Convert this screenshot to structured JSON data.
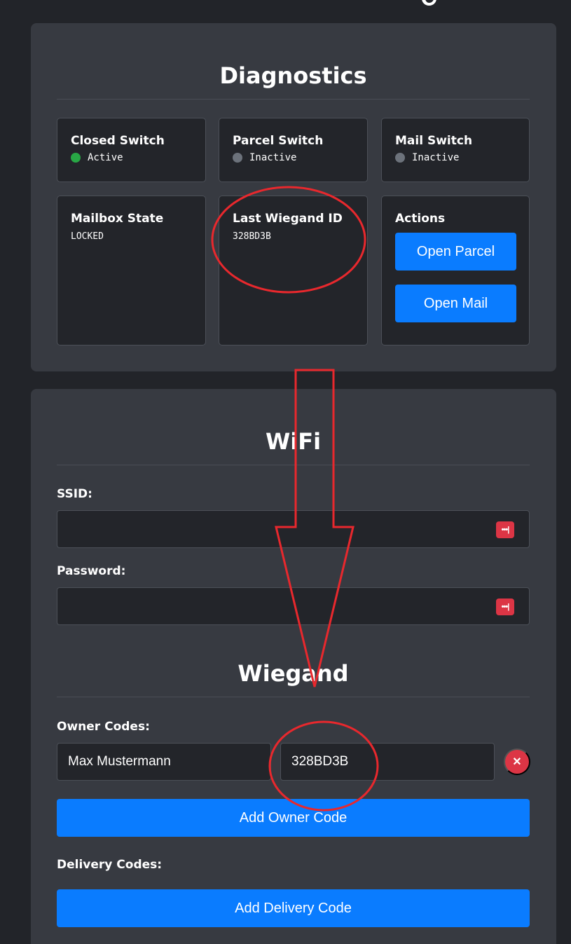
{
  "diagnostics": {
    "title": "Diagnostics",
    "closed_switch": {
      "label": "Closed Switch",
      "status": "Active",
      "status_color": "#28a745"
    },
    "parcel_switch": {
      "label": "Parcel Switch",
      "status": "Inactive",
      "status_color": "#6c727b"
    },
    "mail_switch": {
      "label": "Mail Switch",
      "status": "Inactive",
      "status_color": "#6c727b"
    },
    "mailbox_state": {
      "label": "Mailbox State",
      "value": "LOCKED"
    },
    "last_wiegand": {
      "label": "Last Wiegand ID",
      "value": "328BD3B"
    },
    "actions": {
      "label": "Actions",
      "open_parcel": "Open Parcel",
      "open_mail": "Open Mail"
    }
  },
  "wifi": {
    "title": "WiFi",
    "ssid_label": "SSID:",
    "ssid_value": "",
    "password_label": "Password:",
    "password_value": "",
    "password_manager_icon": "•••|"
  },
  "wiegand": {
    "title": "Wiegand",
    "owner_codes_label": "Owner Codes:",
    "owner_codes": [
      {
        "name": "Max Mustermann",
        "code": "328BD3B"
      }
    ],
    "remove_icon": "✕",
    "add_owner_label": "Add Owner Code",
    "delivery_codes_label": "Delivery Codes:",
    "add_delivery_label": "Add Delivery Code"
  },
  "colors": {
    "accent": "#0a7cff",
    "danger": "#dc3545",
    "annotation": "#e8282d"
  }
}
